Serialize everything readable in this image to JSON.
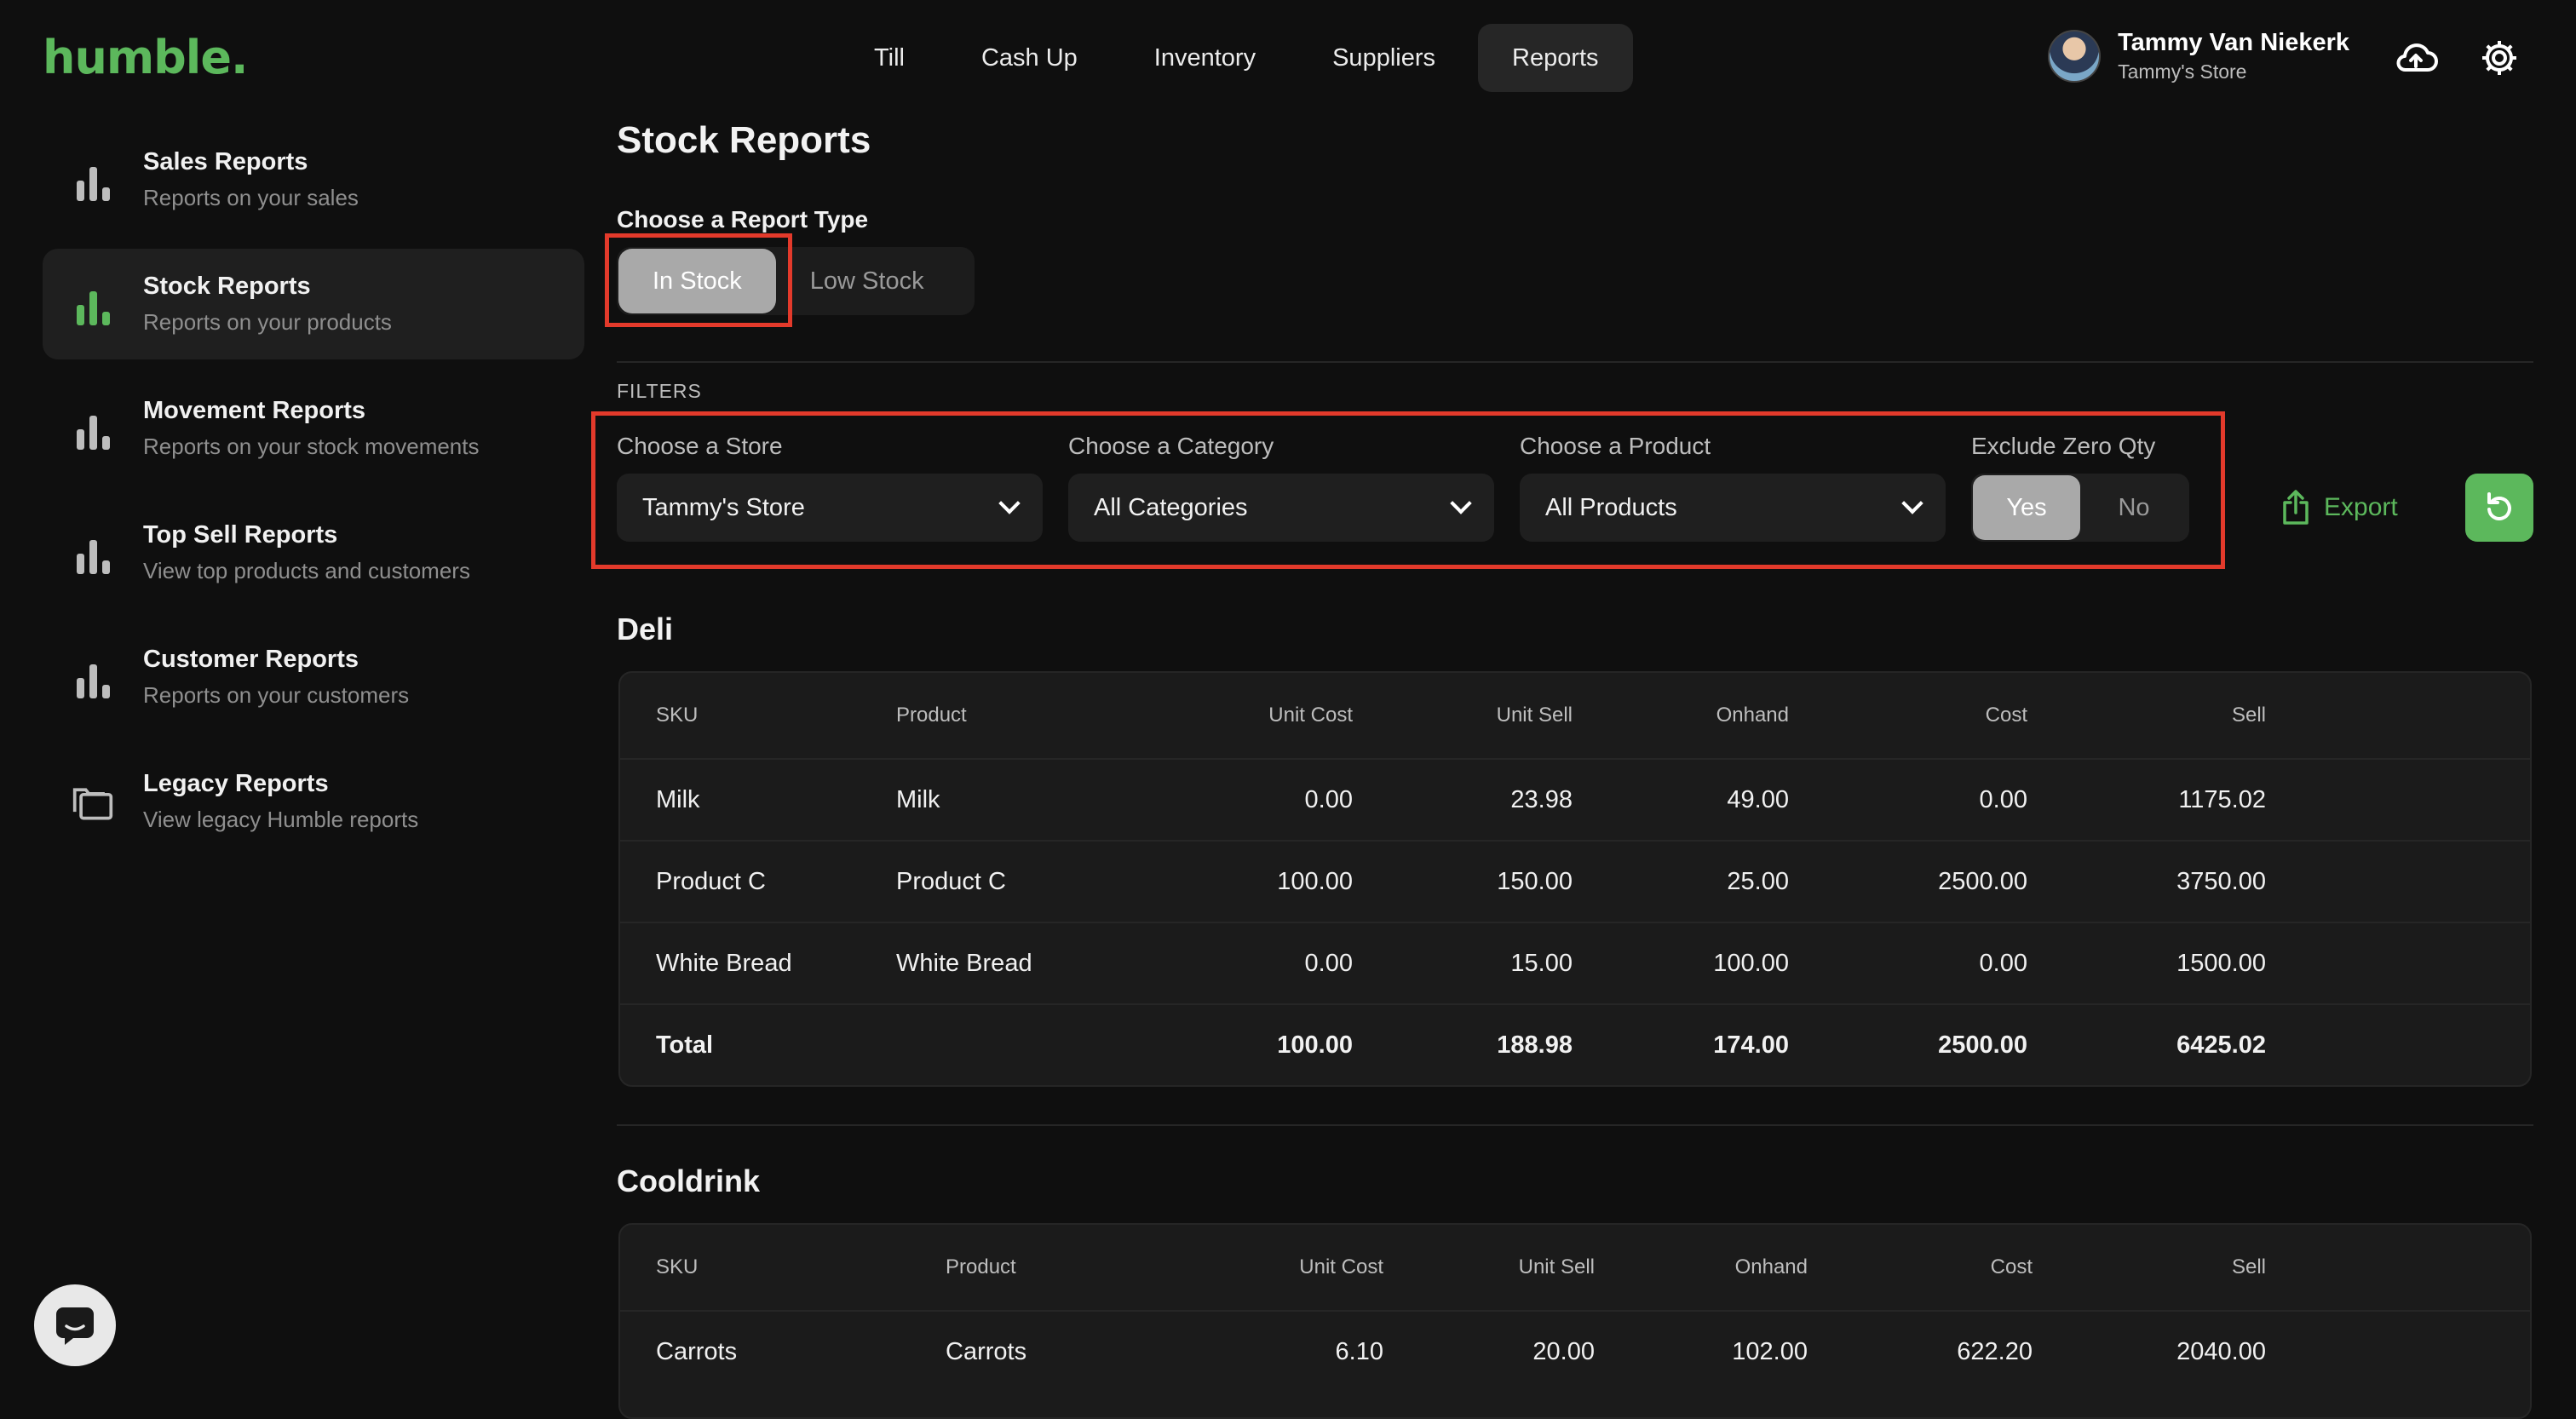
{
  "app": {
    "logo": "humble."
  },
  "nav": {
    "items": [
      "Till",
      "Cash Up",
      "Inventory",
      "Suppliers",
      "Reports"
    ],
    "active": "Reports"
  },
  "user": {
    "name": "Tammy Van Niekerk",
    "store": "Tammy's Store"
  },
  "sidebar": {
    "items": [
      {
        "title": "Sales Reports",
        "subtitle": "Reports on your sales"
      },
      {
        "title": "Stock Reports",
        "subtitle": "Reports on your products"
      },
      {
        "title": "Movement Reports",
        "subtitle": "Reports on your stock movements"
      },
      {
        "title": "Top Sell Reports",
        "subtitle": "View top products and customers"
      },
      {
        "title": "Customer Reports",
        "subtitle": "Reports on your customers"
      },
      {
        "title": "Legacy Reports",
        "subtitle": "View legacy Humble reports"
      }
    ]
  },
  "page": {
    "title": "Stock Reports"
  },
  "report_type": {
    "label": "Choose a Report Type",
    "options": [
      "In Stock",
      "Low Stock"
    ],
    "selected": "In Stock"
  },
  "filters": {
    "section_label": "FILTERS",
    "store": {
      "label": "Choose a Store",
      "value": "Tammy's Store"
    },
    "category": {
      "label": "Choose a Category",
      "value": "All Categories"
    },
    "product": {
      "label": "Choose a Product",
      "value": "All Products"
    },
    "exclude_zero": {
      "label": "Exclude Zero Qty",
      "options": [
        "Yes",
        "No"
      ],
      "selected": "Yes"
    },
    "export_label": "Export"
  },
  "columns": [
    "SKU",
    "Product",
    "Unit Cost",
    "Unit Sell",
    "Onhand",
    "Cost",
    "Sell"
  ],
  "sections": [
    {
      "title": "Deli",
      "rows": [
        [
          "Milk",
          "Milk",
          "0.00",
          "23.98",
          "49.00",
          "0.00",
          "1175.02"
        ],
        [
          "Product C",
          "Product C",
          "100.00",
          "150.00",
          "25.00",
          "2500.00",
          "3750.00"
        ],
        [
          "White Bread",
          "White Bread",
          "0.00",
          "15.00",
          "100.00",
          "0.00",
          "1500.00"
        ]
      ],
      "total": [
        "Total",
        "",
        "100.00",
        "188.98",
        "174.00",
        "2500.00",
        "6425.02"
      ]
    },
    {
      "title": "Cooldrink",
      "rows": [
        [
          "Carrots",
          "Carrots",
          "6.10",
          "20.00",
          "102.00",
          "622.20",
          "2040.00"
        ]
      ]
    }
  ]
}
